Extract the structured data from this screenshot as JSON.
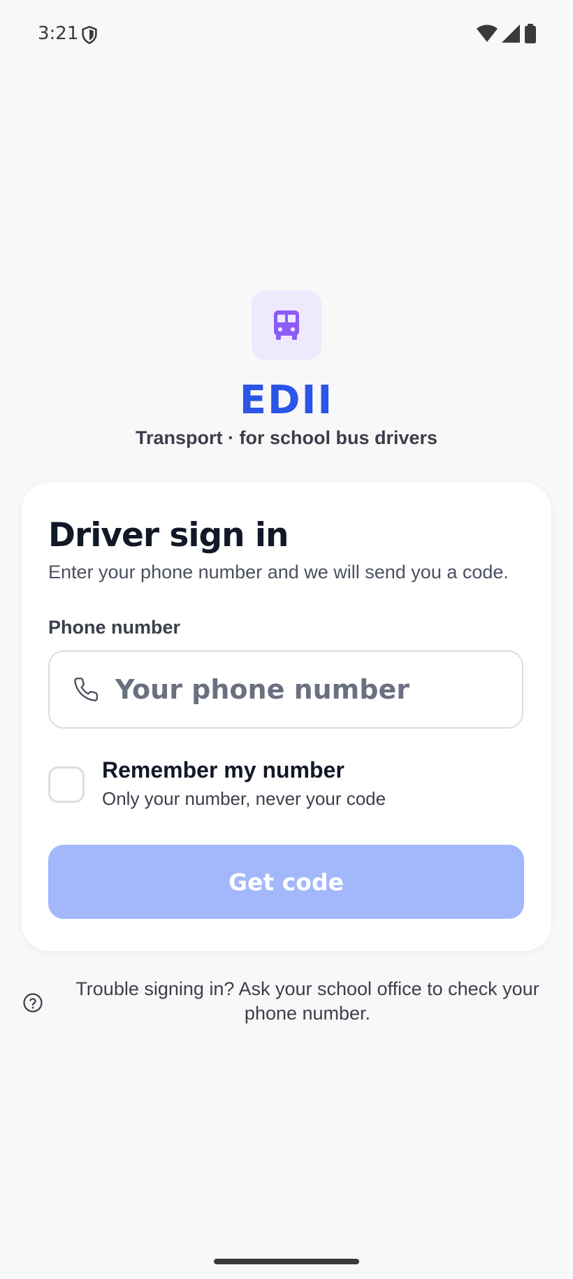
{
  "status_bar": {
    "time": "3:21"
  },
  "app": {
    "brand": "EDII",
    "tagline": "Transport · for school bus drivers",
    "logo_icon": "bus-icon",
    "accent_color": "#2a55e6"
  },
  "signin": {
    "title": "Driver sign in",
    "subtitle": "Enter your phone number and we will send you a code.",
    "phone_label": "Phone number",
    "phone_placeholder": "Your phone number",
    "phone_value": "",
    "remember_title": "Remember my number",
    "remember_subtitle": "Only your number, never your code",
    "remember_checked": false,
    "get_code_label": "Get code",
    "get_code_enabled": false
  },
  "help": {
    "text": "Trouble signing in? Ask your school office to check your phone number."
  }
}
